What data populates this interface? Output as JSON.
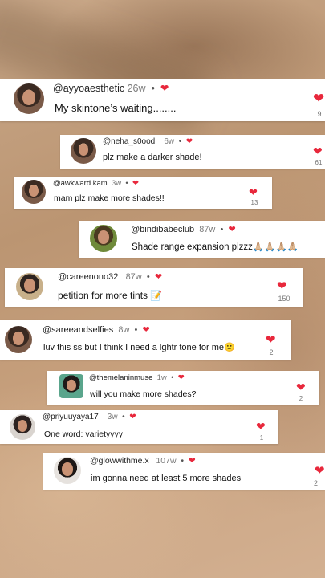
{
  "comments": [
    {
      "username": "@ayyoaesthetic",
      "time": "26w",
      "text": "My skintone’s waiting........",
      "likes": "9"
    },
    {
      "username": "@neha_s0ood",
      "time": "6w",
      "text": "plz make a darker shade!",
      "likes": "61"
    },
    {
      "username": "@awkward.kam",
      "time": "3w",
      "text": "mam plz make more shades!!",
      "likes": "13"
    },
    {
      "username": "@bindibabeclub",
      "time": "87w",
      "text": "Shade range expansion plzzz🙏🏼🙏🏼🙏🏼🙏🏼",
      "likes": ""
    },
    {
      "username": "@careenono32",
      "time": "87w",
      "text": "petition for more tints 📝",
      "likes": "150"
    },
    {
      "username": "@sareeandselfies",
      "time": "8w",
      "text": "luv this ss but I think I need a lghtr tone for me🙂",
      "likes": "2"
    },
    {
      "username": "@themelaninmuse",
      "time": "1w",
      "text": "will you make more shades?",
      "likes": "2"
    },
    {
      "username": "@priyuuyaya17",
      "time": "3w",
      "text": "One word: varietyyyy",
      "likes": "1"
    },
    {
      "username": "@glowwithme.x",
      "time": "107w",
      "text": "im gonna need at least 5 more shades",
      "likes": "2"
    }
  ],
  "icons": {
    "heart": "heart-icon"
  },
  "colors": {
    "heart": "#e8283c"
  }
}
